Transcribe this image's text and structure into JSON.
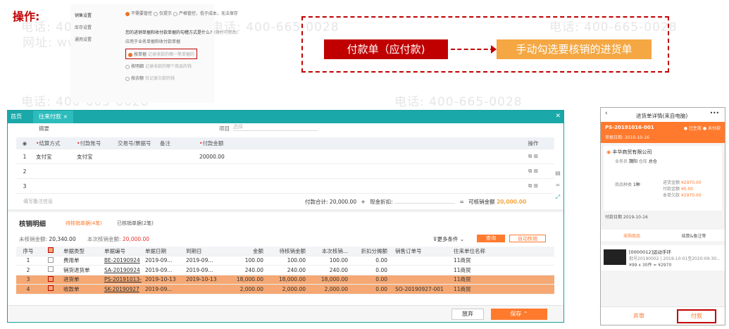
{
  "label_op": "操作:",
  "watermark": {
    "phone": "电话: 400-665-0028",
    "site": "网址: www.chanjet.net"
  },
  "top_settings": {
    "side": [
      "销售设置",
      "库存设置",
      "通用设置"
    ],
    "options": [
      "不需要管控",
      "仅提示",
      "严格管控，低于成本，无法保存"
    ],
    "question": "您的进销单据和收付款单据的勾稽方式是什么?",
    "question_hint": "(随时可修改)",
    "sub": "应用于业务单据和收付款单据",
    "m1": "按单据",
    "m1h": "记录收款的哪一笔单据的",
    "m2": "按明细",
    "m2h": "记录收款的哪个商品的钱",
    "m3": "按余额",
    "m3h": "仅记录欠款的钱"
  },
  "callout": {
    "left": "付款单（应付款)",
    "right": "手动勾选要核销的进货单"
  },
  "win": {
    "tab_home": "首页",
    "tab_active": "往来付款",
    "summary_label": "摘要",
    "project_label": "项目",
    "project_ph": "选择",
    "cols": [
      "结算方式",
      "付款账号",
      "交易号/票据号",
      "备注",
      "付款金额",
      "操作"
    ],
    "rows": [
      {
        "no": "1",
        "method": "支付宝",
        "account": "支付宝",
        "amount": "20000.00"
      },
      {
        "no": "2"
      },
      {
        "no": "3"
      }
    ],
    "remark_ph": "填写备注信息",
    "total_label": "付款合计:",
    "total": "20,000.00",
    "plus": "+",
    "discount_label": "现金折扣:",
    "eq": "=",
    "writeoff_label": "可核销金额",
    "writeoff": "20,000.00",
    "detail_title": "核销明细",
    "tab_pending": "待核销单据(4笔)",
    "tab_done": "已核销单据(2笔)",
    "unsettled_label": "未核销金额:",
    "unsettled": "20,340.00",
    "this_label": "本次核销金额:",
    "this": "20,000.00",
    "more": "更多条件",
    "query": "查询",
    "auto": "自动核销",
    "dcols": [
      "序号",
      "单据类型",
      "单据编号",
      "单据日期",
      "到期日",
      "金额",
      "待核销金额",
      "本次核销...",
      "折扣分摊额",
      "销售订单号",
      "往来单位名称"
    ],
    "drows": [
      {
        "no": "1",
        "type": "费用单",
        "code": "BE-20190924",
        "date": "2019-09...",
        "due": "2019-09...",
        "amt": "100.00",
        "pending": "100.00",
        "this": "100.00",
        "disc": "0.00",
        "so": "",
        "unit": "11商贸",
        "hl": false,
        "chk": false
      },
      {
        "no": "2",
        "type": "销货退货单",
        "code": "SA-20190924",
        "date": "2019-09...",
        "due": "2019-09...",
        "amt": "240.00",
        "pending": "240.00",
        "this": "240.00",
        "disc": "0.00",
        "so": "",
        "unit": "11商贸",
        "hl": false,
        "chk": false
      },
      {
        "no": "3",
        "type": "进货单",
        "code": "PS-20191013-",
        "date": "2019-10-13",
        "due": "2019-10-13",
        "amt": "18,000.00",
        "pending": "18,000.00",
        "this": "18,000.00",
        "disc": "0.00",
        "so": "",
        "unit": "11商贸",
        "hl": true,
        "chk": true
      },
      {
        "no": "4",
        "type": "收款单",
        "code": "SK-20190927",
        "date": "2019-09...",
        "due": "",
        "amt": "2,000.00",
        "pending": "2,000.00",
        "this": "2,000.00",
        "disc": "0.00",
        "so": "SO-20190927-001",
        "unit": "11商贸",
        "hl": true,
        "chk": true
      }
    ],
    "giveup": "放弃",
    "save": "保存"
  },
  "phone": {
    "title": "进货单详情(来自电脑)",
    "code": "PS-20191016-001",
    "status1": "已生效",
    "status2": "未付款",
    "date_label": "单据日期",
    "date": "2019-10-16",
    "supplier": "丰华商贸有限公司",
    "staff_label": "业务员",
    "staff": "魏阳",
    "wh_label": "仓库",
    "wh": "总仓",
    "qty_label": "商品种类",
    "qty": "1种",
    "l1": "进货金额",
    "v1": "¥2970.00",
    "l2": "付款金额",
    "v2": "¥0.00",
    "l3": "本单欠款",
    "v3": "¥2970.00",
    "pay_date": "付款日期 2019-10-16",
    "tab1": "采购商品",
    "tab2": "结算&备注等",
    "item": "[0000012]运动手环",
    "item_sub": "批号20190002 | 2019-10-01至2020-09-30...",
    "item_price": "¥99 x 30件 = ¥2970",
    "btn1": "弃审",
    "btn2": "付款"
  }
}
